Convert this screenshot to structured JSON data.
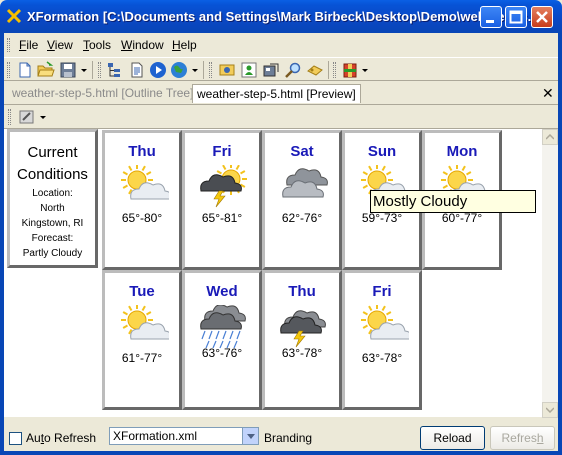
{
  "window": {
    "title": "XFormation [C:\\Documents and Settings\\Mark Birbeck\\Desktop\\Demo\\web-servic..."
  },
  "menu": [
    "File",
    "View",
    "Tools",
    "Window",
    "Help"
  ],
  "menu_mnemonics": [
    "F",
    "V",
    "T",
    "W",
    "H"
  ],
  "toolbar_icons": [
    "new-document-icon",
    "open-folder-icon",
    "save-icon",
    "tree-view-icon",
    "page-icon",
    "play-icon",
    "globe-icon",
    "image-icon",
    "users-icon",
    "properties-icon",
    "find-icon",
    "link-icon",
    "package-icon"
  ],
  "tabs": {
    "outline": "weather-step-5.html [Outline Tree]",
    "preview": "weather-step-5.html [Preview]"
  },
  "current": {
    "heading_line1": "Current",
    "heading_line2": "Conditions",
    "location_label": "Location:",
    "location_line1": "North",
    "location_line2": "Kingstown, RI",
    "forecast_label": "Forecast:",
    "forecast_value": "Partly Cloudy"
  },
  "forecast": [
    {
      "day": "Thu",
      "temp": "65°-80°",
      "icon": "partly-cloudy-icon"
    },
    {
      "day": "Fri",
      "temp": "65°-81°",
      "icon": "thunderstorm-sun-icon"
    },
    {
      "day": "Sat",
      "temp": "62°-76°",
      "icon": "cloudy-icon"
    },
    {
      "day": "Sun",
      "temp": "59°-73°",
      "icon": "partly-cloudy-icon"
    },
    {
      "day": "Mon",
      "temp": "60°-77°",
      "icon": "partly-cloudy-icon"
    },
    {
      "day": "Tue",
      "temp": "61°-77°",
      "icon": "partly-cloudy-icon"
    },
    {
      "day": "Wed",
      "temp": "63°-76°",
      "icon": "rain-icon"
    },
    {
      "day": "Thu",
      "temp": "63°-78°",
      "icon": "thunderstorm-icon"
    },
    {
      "day": "Fri",
      "temp": "63°-78°",
      "icon": "partly-cloudy-icon"
    }
  ],
  "tooltip": "Mostly Cloudy",
  "bottom": {
    "auto_refresh": "Auto Refresh",
    "auto_refresh_checked": false,
    "select_value": "XFormation.xml",
    "branding": "Branding",
    "reload": "Reload",
    "refresh": "Refresh"
  },
  "colors": {
    "title_bar": "#0a47c4",
    "day_label": "#1a1ab8",
    "tooltip_bg": "#ffffe1"
  }
}
